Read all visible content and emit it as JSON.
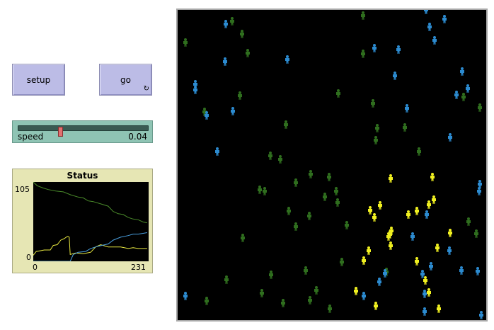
{
  "buttons": {
    "setup_label": "setup",
    "go_label": "go",
    "go_forever_icon": "↻"
  },
  "slider": {
    "name": "speed",
    "value": "0.04",
    "position_fraction": 0.32
  },
  "plot": {
    "title": "Status",
    "y_max_label": "105",
    "y_min_label": "0",
    "x_min_label": "0",
    "x_max_label": "231"
  },
  "chart_data": {
    "type": "line",
    "title": "Status",
    "xlim": [
      0,
      231
    ],
    "ylim": [
      0,
      105
    ],
    "series": [
      {
        "color": "#4a8a2a",
        "points": [
          [
            0,
            105
          ],
          [
            8,
            100
          ],
          [
            20,
            97
          ],
          [
            30,
            95
          ],
          [
            45,
            93
          ],
          [
            60,
            92
          ],
          [
            75,
            88
          ],
          [
            90,
            85
          ],
          [
            100,
            84
          ],
          [
            110,
            80
          ],
          [
            120,
            79
          ],
          [
            135,
            76
          ],
          [
            150,
            73
          ],
          [
            160,
            66
          ],
          [
            170,
            63
          ],
          [
            180,
            62
          ],
          [
            190,
            58
          ],
          [
            200,
            56
          ],
          [
            210,
            55
          ],
          [
            220,
            52
          ],
          [
            228,
            51
          ]
        ]
      },
      {
        "color": "#e8e840",
        "points": [
          [
            0,
            8
          ],
          [
            6,
            13
          ],
          [
            14,
            14
          ],
          [
            22,
            15
          ],
          [
            34,
            15
          ],
          [
            40,
            21
          ],
          [
            48,
            22
          ],
          [
            55,
            28
          ],
          [
            62,
            30
          ],
          [
            66,
            32
          ],
          [
            69,
            33
          ],
          [
            72,
            32
          ],
          [
            74,
            9
          ],
          [
            85,
            11
          ],
          [
            100,
            10
          ],
          [
            115,
            12
          ],
          [
            125,
            19
          ],
          [
            135,
            22
          ],
          [
            150,
            19
          ],
          [
            160,
            19
          ],
          [
            175,
            19
          ],
          [
            190,
            17
          ],
          [
            200,
            18
          ],
          [
            210,
            17
          ],
          [
            220,
            17
          ],
          [
            228,
            17
          ]
        ]
      },
      {
        "color": "#4aa0e0",
        "points": [
          [
            0,
            0
          ],
          [
            74,
            0
          ],
          [
            80,
            9
          ],
          [
            90,
            12
          ],
          [
            105,
            13
          ],
          [
            115,
            17
          ],
          [
            130,
            20
          ],
          [
            150,
            23
          ],
          [
            160,
            28
          ],
          [
            175,
            32
          ],
          [
            190,
            34
          ],
          [
            200,
            36
          ],
          [
            210,
            36
          ],
          [
            220,
            37
          ],
          [
            228,
            38
          ]
        ]
      }
    ]
  },
  "world": {
    "colors": {
      "sick": "#2f6e1e",
      "healthy": "#2c8bd0",
      "immune": "#f0f020"
    },
    "turtles": [
      {
        "x": 513,
        "y": 22,
        "s": "sick"
      },
      {
        "x": 328,
        "y": 30,
        "s": "sick"
      },
      {
        "x": 342,
        "y": 48,
        "s": "sick"
      },
      {
        "x": 262,
        "y": 60,
        "s": "sick"
      },
      {
        "x": 350,
        "y": 75,
        "s": "sick"
      },
      {
        "x": 513,
        "y": 76,
        "s": "sick"
      },
      {
        "x": 339,
        "y": 135,
        "s": "sick"
      },
      {
        "x": 478,
        "y": 132,
        "s": "sick"
      },
      {
        "x": 527,
        "y": 146,
        "s": "sick"
      },
      {
        "x": 289,
        "y": 158,
        "s": "sick"
      },
      {
        "x": 678,
        "y": 152,
        "s": "sick"
      },
      {
        "x": 404,
        "y": 176,
        "s": "sick"
      },
      {
        "x": 572,
        "y": 180,
        "s": "sick"
      },
      {
        "x": 533,
        "y": 181,
        "s": "sick"
      },
      {
        "x": 531,
        "y": 198,
        "s": "sick"
      },
      {
        "x": 592,
        "y": 214,
        "s": "sick"
      },
      {
        "x": 382,
        "y": 220,
        "s": "sick"
      },
      {
        "x": 396,
        "y": 225,
        "s": "sick"
      },
      {
        "x": 439,
        "y": 246,
        "s": "sick"
      },
      {
        "x": 465,
        "y": 250,
        "s": "sick"
      },
      {
        "x": 418,
        "y": 258,
        "s": "sick"
      },
      {
        "x": 367,
        "y": 268,
        "s": "sick"
      },
      {
        "x": 374,
        "y": 270,
        "s": "sick"
      },
      {
        "x": 475,
        "y": 270,
        "s": "sick"
      },
      {
        "x": 459,
        "y": 278,
        "s": "sick"
      },
      {
        "x": 477,
        "y": 286,
        "s": "sick"
      },
      {
        "x": 408,
        "y": 298,
        "s": "sick"
      },
      {
        "x": 437,
        "y": 305,
        "s": "sick"
      },
      {
        "x": 418,
        "y": 320,
        "s": "sick"
      },
      {
        "x": 490,
        "y": 318,
        "s": "sick"
      },
      {
        "x": 343,
        "y": 336,
        "s": "sick"
      },
      {
        "x": 662,
        "y": 313,
        "s": "sick"
      },
      {
        "x": 673,
        "y": 330,
        "s": "sick"
      },
      {
        "x": 483,
        "y": 370,
        "s": "sick"
      },
      {
        "x": 432,
        "y": 382,
        "s": "sick"
      },
      {
        "x": 383,
        "y": 388,
        "s": "sick"
      },
      {
        "x": 320,
        "y": 395,
        "s": "sick"
      },
      {
        "x": 447,
        "y": 410,
        "s": "sick"
      },
      {
        "x": 370,
        "y": 414,
        "s": "sick"
      },
      {
        "x": 292,
        "y": 425,
        "s": "sick"
      },
      {
        "x": 400,
        "y": 428,
        "s": "sick"
      },
      {
        "x": 438,
        "y": 424,
        "s": "sick"
      },
      {
        "x": 466,
        "y": 436,
        "s": "sick"
      },
      {
        "x": 546,
        "y": 384,
        "s": "sick"
      },
      {
        "x": 655,
        "y": 137,
        "s": "sick"
      },
      {
        "x": 602,
        "y": 14,
        "s": "healthy"
      },
      {
        "x": 319,
        "y": 34,
        "s": "healthy"
      },
      {
        "x": 607,
        "y": 38,
        "s": "healthy"
      },
      {
        "x": 628,
        "y": 27,
        "s": "healthy"
      },
      {
        "x": 614,
        "y": 57,
        "s": "healthy"
      },
      {
        "x": 529,
        "y": 68,
        "s": "healthy"
      },
      {
        "x": 563,
        "y": 70,
        "s": "healthy"
      },
      {
        "x": 406,
        "y": 84,
        "s": "healthy"
      },
      {
        "x": 318,
        "y": 87,
        "s": "healthy"
      },
      {
        "x": 558,
        "y": 107,
        "s": "healthy"
      },
      {
        "x": 653,
        "y": 101,
        "s": "healthy"
      },
      {
        "x": 276,
        "y": 119,
        "s": "healthy"
      },
      {
        "x": 276,
        "y": 127,
        "s": "healthy"
      },
      {
        "x": 661,
        "y": 125,
        "s": "healthy"
      },
      {
        "x": 645,
        "y": 134,
        "s": "healthy"
      },
      {
        "x": 575,
        "y": 153,
        "s": "healthy"
      },
      {
        "x": 329,
        "y": 157,
        "s": "healthy"
      },
      {
        "x": 292,
        "y": 163,
        "s": "healthy"
      },
      {
        "x": 636,
        "y": 194,
        "s": "healthy"
      },
      {
        "x": 307,
        "y": 214,
        "s": "healthy"
      },
      {
        "x": 678,
        "y": 260,
        "s": "healthy"
      },
      {
        "x": 677,
        "y": 270,
        "s": "healthy"
      },
      {
        "x": 603,
        "y": 303,
        "s": "healthy"
      },
      {
        "x": 583,
        "y": 334,
        "s": "healthy"
      },
      {
        "x": 635,
        "y": 354,
        "s": "healthy"
      },
      {
        "x": 544,
        "y": 386,
        "s": "healthy"
      },
      {
        "x": 609,
        "y": 376,
        "s": "healthy"
      },
      {
        "x": 597,
        "y": 387,
        "s": "healthy"
      },
      {
        "x": 652,
        "y": 382,
        "s": "healthy"
      },
      {
        "x": 675,
        "y": 383,
        "s": "healthy"
      },
      {
        "x": 536,
        "y": 398,
        "s": "healthy"
      },
      {
        "x": 514,
        "y": 418,
        "s": "healthy"
      },
      {
        "x": 600,
        "y": 415,
        "s": "healthy"
      },
      {
        "x": 262,
        "y": 418,
        "s": "healthy"
      },
      {
        "x": 600,
        "y": 440,
        "s": "healthy"
      },
      {
        "x": 680,
        "y": 445,
        "s": "healthy"
      },
      {
        "x": 552,
        "y": 252,
        "s": "immune"
      },
      {
        "x": 611,
        "y": 250,
        "s": "immune"
      },
      {
        "x": 613,
        "y": 282,
        "s": "immune"
      },
      {
        "x": 606,
        "y": 289,
        "s": "immune"
      },
      {
        "x": 523,
        "y": 297,
        "s": "immune"
      },
      {
        "x": 537,
        "y": 290,
        "s": "immune"
      },
      {
        "x": 577,
        "y": 303,
        "s": "immune"
      },
      {
        "x": 589,
        "y": 298,
        "s": "immune"
      },
      {
        "x": 529,
        "y": 307,
        "s": "immune"
      },
      {
        "x": 553,
        "y": 326,
        "s": "immune"
      },
      {
        "x": 551,
        "y": 331,
        "s": "immune"
      },
      {
        "x": 549,
        "y": 334,
        "s": "immune"
      },
      {
        "x": 636,
        "y": 329,
        "s": "immune"
      },
      {
        "x": 552,
        "y": 347,
        "s": "immune"
      },
      {
        "x": 618,
        "y": 350,
        "s": "immune"
      },
      {
        "x": 521,
        "y": 354,
        "s": "immune"
      },
      {
        "x": 514,
        "y": 368,
        "s": "immune"
      },
      {
        "x": 589,
        "y": 369,
        "s": "immune"
      },
      {
        "x": 601,
        "y": 396,
        "s": "immune"
      },
      {
        "x": 503,
        "y": 411,
        "s": "immune"
      },
      {
        "x": 606,
        "y": 413,
        "s": "immune"
      },
      {
        "x": 531,
        "y": 432,
        "s": "immune"
      },
      {
        "x": 620,
        "y": 436,
        "s": "immune"
      }
    ]
  }
}
